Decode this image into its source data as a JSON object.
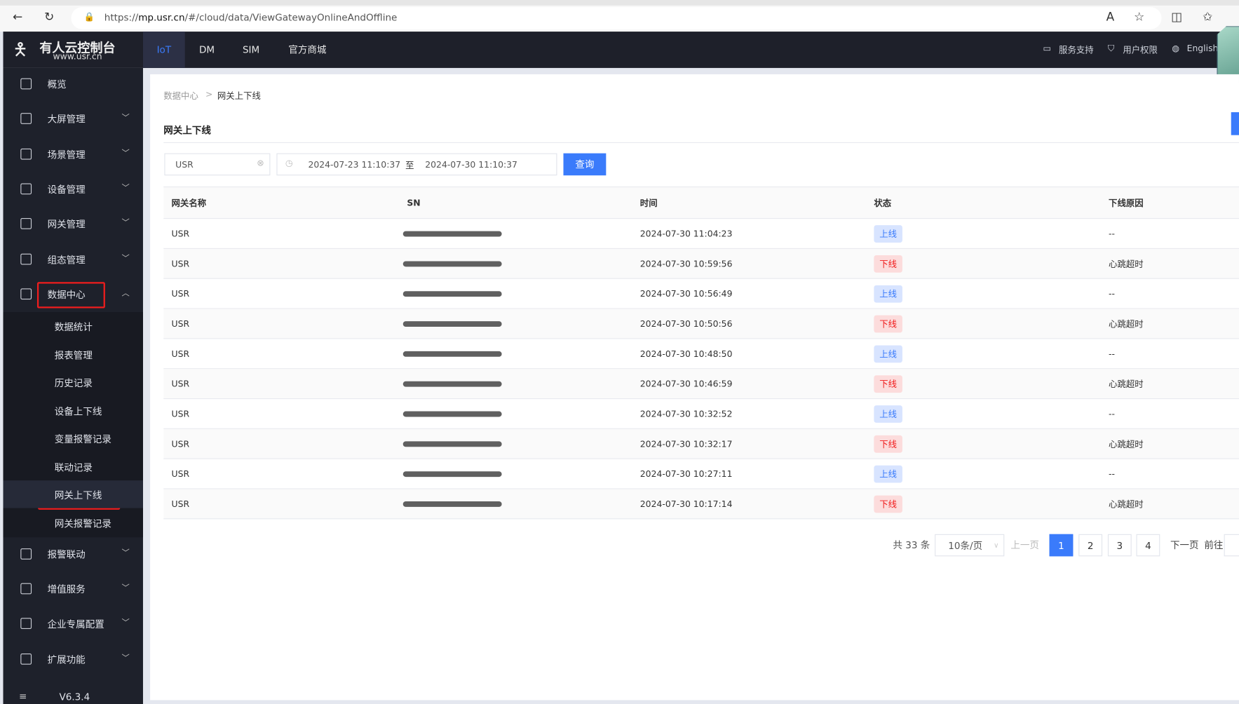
{
  "browser": {
    "url_prefix": "https://",
    "url_host": "mp.usr.cn",
    "url_path": "/#/cloud/data/ViewGatewayOnlineAndOffline"
  },
  "brand": {
    "name": "有人云控制台",
    "site": "www.usr.cn"
  },
  "topnav": {
    "tabs": [
      {
        "label": "IoT",
        "active": true
      },
      {
        "label": "DM"
      },
      {
        "label": "SIM"
      },
      {
        "label": "官方商城"
      }
    ],
    "right": {
      "support": "服务支持",
      "permissions": "用户权限",
      "language": "English"
    }
  },
  "sidebar": {
    "items": [
      {
        "label": "概览",
        "icon": "overview-icon"
      },
      {
        "label": "大屏管理",
        "icon": "screen-icon"
      },
      {
        "label": "场景管理",
        "icon": "scene-icon"
      },
      {
        "label": "设备管理",
        "icon": "device-icon"
      },
      {
        "label": "网关管理",
        "icon": "gateway-icon"
      },
      {
        "label": "组态管理",
        "icon": "config-icon"
      },
      {
        "label": "数据中心",
        "icon": "chart-icon",
        "expanded": true
      }
    ],
    "sub": [
      "数据统计",
      "报表管理",
      "历史记录",
      "设备上下线",
      "变量报警记录",
      "联动记录",
      "网关上下线",
      "网关报警记录"
    ],
    "active_sub": "网关上下线",
    "items_after": [
      {
        "label": "报警联动"
      },
      {
        "label": "增值服务"
      },
      {
        "label": "企业专属配置"
      },
      {
        "label": "扩展功能"
      }
    ],
    "version": "V6.3.4"
  },
  "breadcrumb": {
    "parent": "数据中心",
    "sep": ">",
    "current": "网关上下线"
  },
  "page_title": "网关上下线",
  "filters": {
    "name": "USR",
    "start": "2024-07-23 11:10:37",
    "range_sep": "至",
    "end": "2024-07-30 11:10:37",
    "query": "查询"
  },
  "table": {
    "headers": [
      "网关名称",
      "SN",
      "时间",
      "状态",
      "下线原因"
    ],
    "rows": [
      {
        "name": "USR",
        "time": "2024-07-30 11:04:23",
        "status": "上线",
        "reason": "--"
      },
      {
        "name": "USR",
        "time": "2024-07-30 10:59:56",
        "status": "下线",
        "reason": "心跳超时"
      },
      {
        "name": "USR",
        "time": "2024-07-30 10:56:49",
        "status": "上线",
        "reason": "--"
      },
      {
        "name": "USR",
        "time": "2024-07-30 10:50:56",
        "status": "下线",
        "reason": "心跳超时"
      },
      {
        "name": "USR",
        "time": "2024-07-30 10:48:50",
        "status": "上线",
        "reason": "--"
      },
      {
        "name": "USR",
        "time": "2024-07-30 10:46:59",
        "status": "下线",
        "reason": "心跳超时"
      },
      {
        "name": "USR",
        "time": "2024-07-30 10:32:52",
        "status": "上线",
        "reason": "--"
      },
      {
        "name": "USR",
        "time": "2024-07-30 10:32:17",
        "status": "下线",
        "reason": "心跳超时"
      },
      {
        "name": "USR",
        "time": "2024-07-30 10:27:11",
        "status": "上线",
        "reason": "--"
      },
      {
        "name": "USR",
        "time": "2024-07-30 10:17:14",
        "status": "下线",
        "reason": "心跳超时"
      }
    ]
  },
  "pagination": {
    "total": "共 33 条",
    "page_size": "10条/页",
    "prev": "上一页",
    "pages": [
      "1",
      "2",
      "3",
      "4"
    ],
    "current": "1",
    "next": "下一页",
    "goto": "前往"
  },
  "colors": {
    "accent": "#3a7bfb",
    "online_bg": "#d8e4ff",
    "offline_bg": "#fcdcdc",
    "offline": "#f01d1d",
    "sidebar": "#1e212b",
    "highlight": "#f01d1d"
  }
}
